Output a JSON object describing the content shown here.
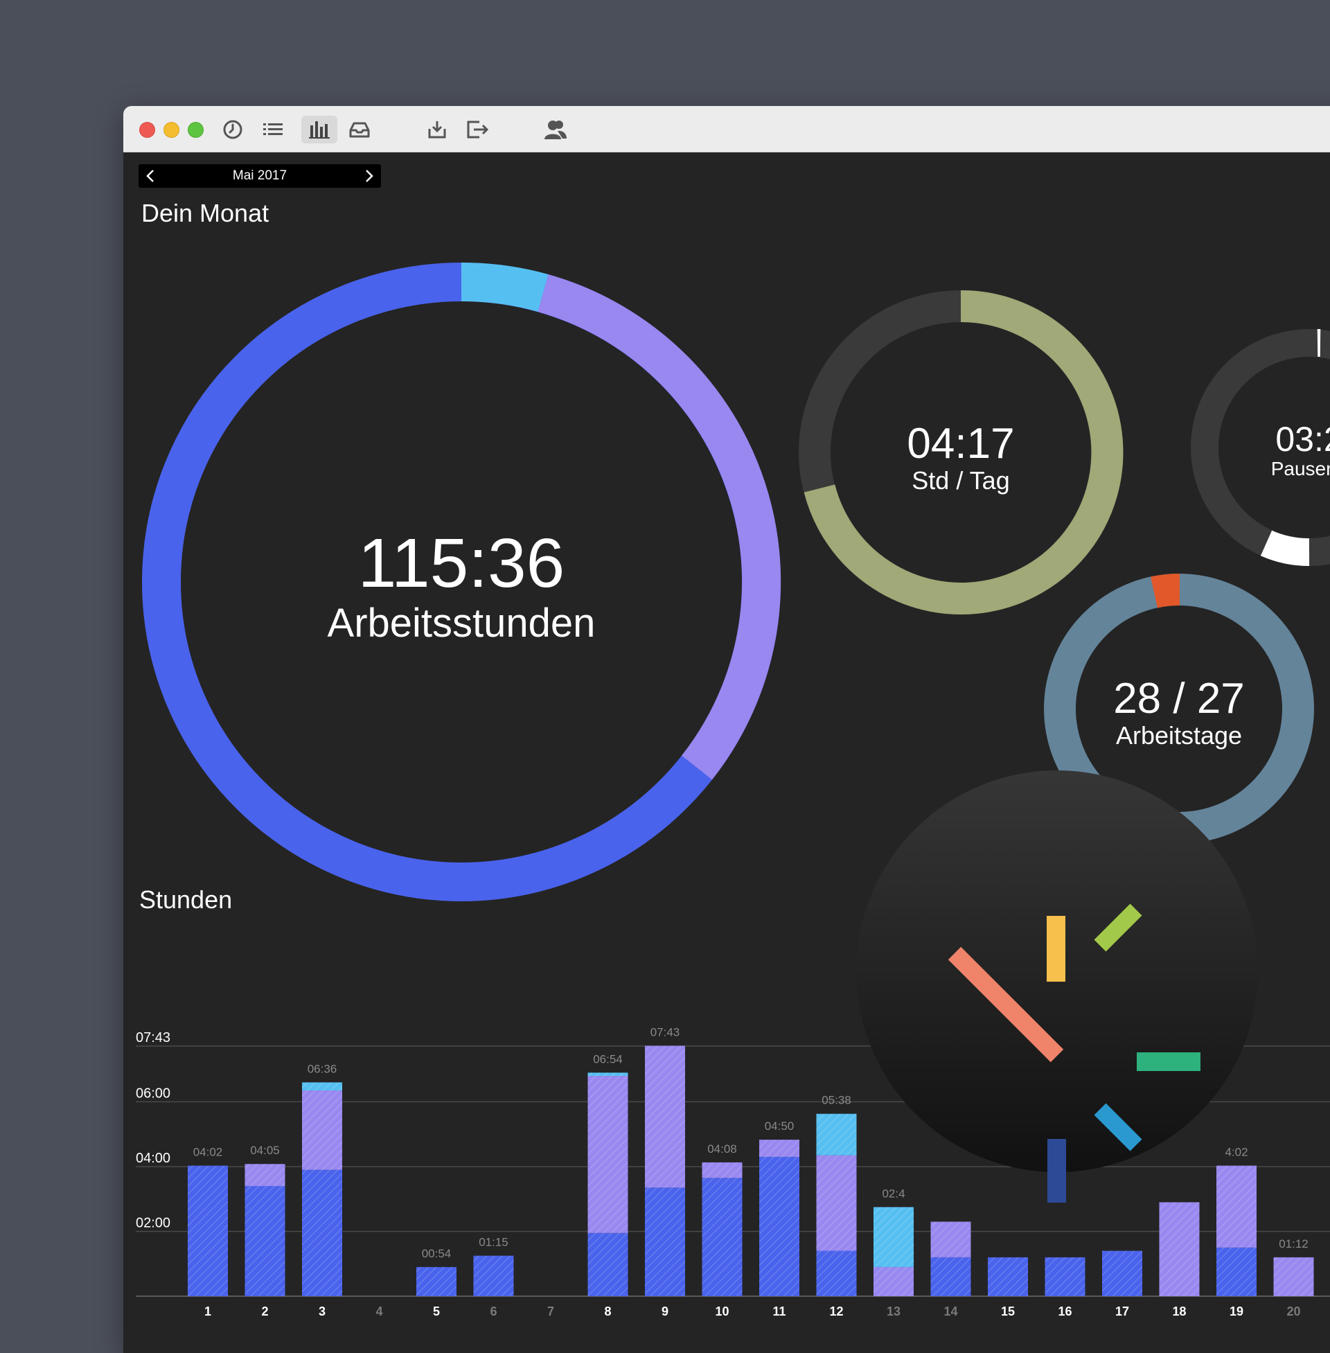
{
  "toolbar": {
    "icons": [
      "clock-icon",
      "list-icon",
      "bar-chart-icon",
      "inbox-icon",
      "download-icon",
      "export-icon",
      "users-icon"
    ],
    "active": "bar-chart-icon"
  },
  "month_nav": {
    "label": "Mai 2017"
  },
  "section_month": {
    "title": "Dein Monat"
  },
  "rings": {
    "hours": {
      "value": "115:36",
      "label": "Arbeitsstunden"
    },
    "per_day": {
      "value": "04:17",
      "label": "Std / Tag"
    },
    "breaks": {
      "value": "03:2",
      "label": "Pausen /"
    },
    "workdays": {
      "value": "28 / 27",
      "label": "Arbeitstage"
    }
  },
  "colors": {
    "blue": "#4a63ec",
    "purple": "#9888f0",
    "cyan": "#56bff1",
    "olive": "#a0a977",
    "steel": "#64849a",
    "orange": "#e2582a",
    "track": "#3a3a3a"
  },
  "section_hours": {
    "title": "Stunden"
  },
  "chart_data": {
    "type": "bar",
    "stacked": true,
    "title": "Stunden",
    "y_unit": "hours",
    "y_ticks": [
      "02:00",
      "04:00",
      "06:00",
      "07:43"
    ],
    "y_tick_values": [
      2,
      4,
      6,
      7.72
    ],
    "ylim": [
      0,
      7.72
    ],
    "categories": [
      "1",
      "2",
      "3",
      "4",
      "5",
      "6",
      "7",
      "8",
      "9",
      "10",
      "11",
      "12",
      "13",
      "14",
      "15",
      "16",
      "17",
      "18",
      "19",
      "20"
    ],
    "value_labels": [
      "04:02",
      "04:05",
      "06:36",
      "",
      "00:54",
      "01:15",
      "",
      "06:54",
      "07:43",
      "04:08",
      "04:50",
      "05:38",
      "02:4",
      "",
      "",
      "",
      "",
      "",
      "4:02",
      "01:12"
    ],
    "series": [
      {
        "color": "#4a63ec",
        "values": [
          4.03,
          3.4,
          3.9,
          0,
          0.9,
          1.25,
          0,
          1.95,
          3.35,
          3.65,
          4.3,
          1.4,
          0,
          1.2,
          1.2,
          1.2,
          1.4,
          0,
          1.5,
          0
        ]
      },
      {
        "color": "#9888f0",
        "values": [
          0,
          0.68,
          2.45,
          0,
          0,
          0,
          0,
          4.85,
          4.38,
          0.48,
          0.53,
          2.95,
          0.9,
          1.1,
          0,
          0,
          0,
          2.9,
          2.53,
          1.2
        ]
      },
      {
        "color": "#56bff1",
        "values": [
          0,
          0,
          0.25,
          0,
          0,
          0,
          0,
          0.1,
          0,
          0,
          0,
          1.28,
          1.85,
          0,
          0,
          0,
          0,
          0,
          0,
          0
        ]
      }
    ],
    "x_label_muted": [
      "4",
      "6",
      "7",
      "13",
      "14",
      "20"
    ]
  }
}
